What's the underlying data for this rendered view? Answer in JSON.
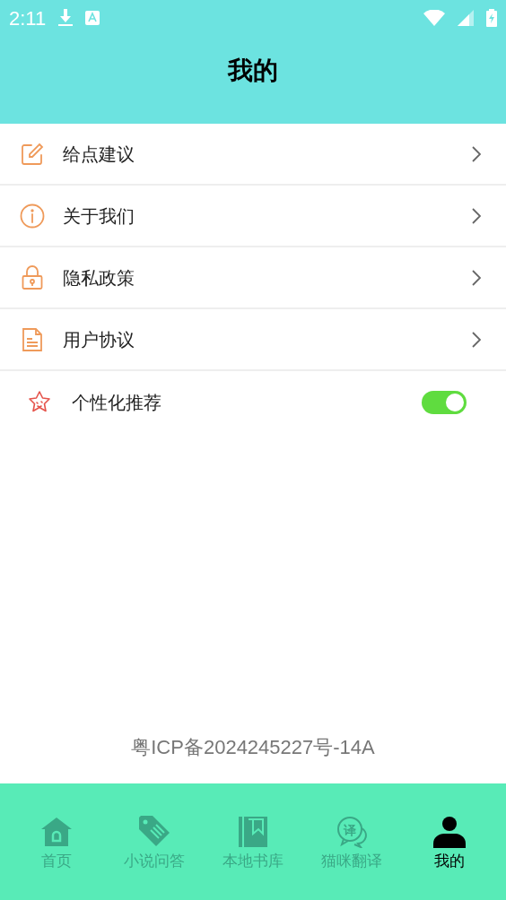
{
  "status_bar": {
    "time": "2:11"
  },
  "header": {
    "title": "我的"
  },
  "menu": [
    {
      "kind": "link",
      "label": "给点建议"
    },
    {
      "kind": "link",
      "label": "关于我们"
    },
    {
      "kind": "link",
      "label": "隐私政策"
    },
    {
      "kind": "link",
      "label": "用户协议"
    },
    {
      "kind": "toggle",
      "label": "个性化推荐",
      "on": true
    }
  ],
  "footer": {
    "icp": "粤ICP备2024245227号-14A"
  },
  "nav": [
    {
      "label": "首页",
      "selected": false
    },
    {
      "label": "小说问答",
      "selected": false
    },
    {
      "label": "本地书库",
      "selected": false
    },
    {
      "icon_text": "译",
      "label": "猫咪翻译",
      "selected": false
    },
    {
      "label": "我的",
      "selected": true
    }
  ]
}
